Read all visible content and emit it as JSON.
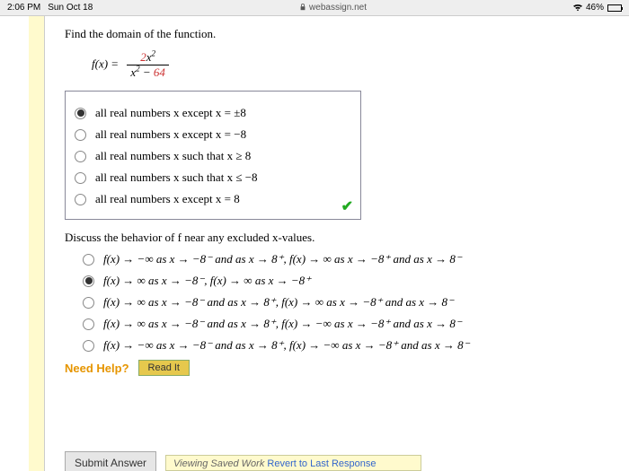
{
  "status": {
    "time": "2:06 PM",
    "date": "Sun Oct 18",
    "domain": "webassign.net",
    "battery": "46%"
  },
  "q1": {
    "prompt": "Find the domain of the function.",
    "fx_label": "f(x) =",
    "num_coeff": "2",
    "num_var": "x",
    "num_exp": "2",
    "den_var": "x",
    "den_exp": "2",
    "den_op": " − ",
    "den_const": "64",
    "options": [
      "all real numbers x except x = ±8",
      "all real numbers x except x = −8",
      "all real numbers x such that x ≥ 8",
      "all real numbers x such that x ≤ −8",
      "all real numbers x except x = 8"
    ],
    "selected": 0
  },
  "q2": {
    "prompt": "Discuss the behavior of f near any excluded x-values.",
    "options": [
      "f(x) → −∞ as x → −8⁻ and as x → 8⁺, f(x) → ∞ as x → −8⁺ and as x → 8⁻",
      "f(x) → ∞ as x → −8⁻, f(x) → ∞ as x → −8⁺",
      "f(x) → ∞ as x → −8⁻ and as x → 8⁺, f(x) → ∞ as x → −8⁺ and as x → 8⁻",
      "f(x) → ∞ as x → −8⁻ and as x → 8⁺, f(x) → −∞ as x → −8⁺ and as x → 8⁻",
      "f(x) → −∞ as x → −8⁻ and as x → 8⁺, f(x) → −∞ as x → −8⁺ and as x → 8⁻"
    ],
    "selected": 1
  },
  "help": {
    "label": "Need Help?",
    "read_it": "Read It"
  },
  "footer": {
    "submit": "Submit Answer",
    "saved_prefix": "Viewing Saved Work ",
    "revert": "Revert to Last Response"
  }
}
